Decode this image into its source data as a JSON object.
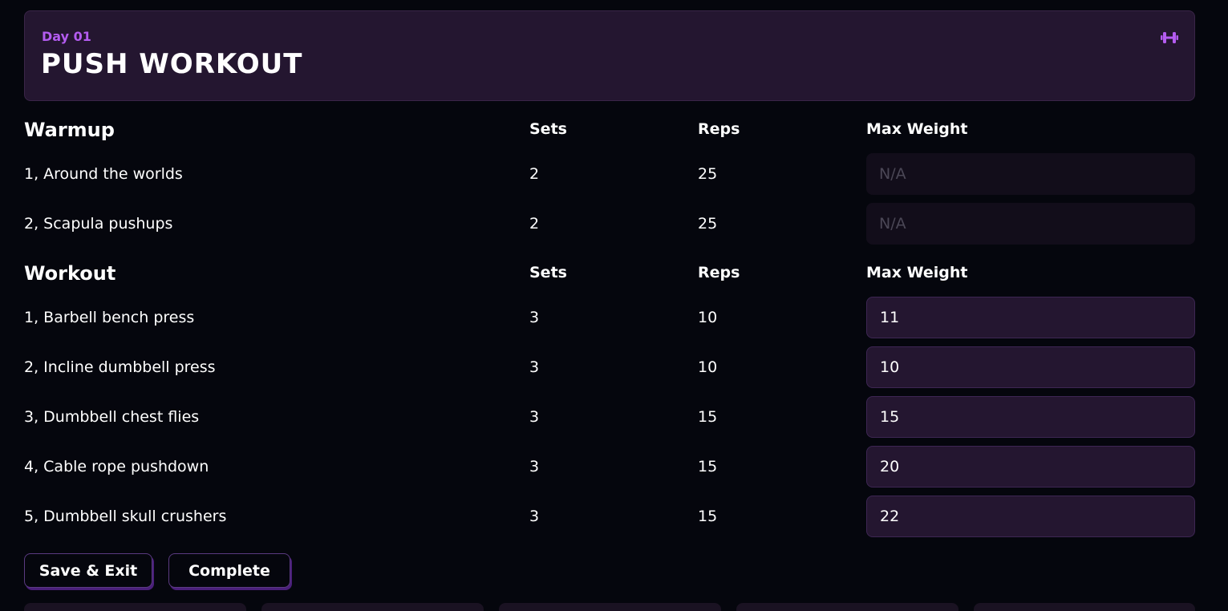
{
  "header": {
    "day_label": "Day 01",
    "title": "PUSH WORKOUT",
    "icon": "dumbbell-icon"
  },
  "columns": {
    "sets": "Sets",
    "reps": "Reps",
    "max_weight": "Max Weight"
  },
  "warmup": {
    "title": "Warmup",
    "rows": [
      {
        "name": "1, Around the worlds",
        "sets": "2",
        "reps": "25",
        "weight_placeholder": "N/A",
        "weight": ""
      },
      {
        "name": "2, Scapula pushups",
        "sets": "2",
        "reps": "25",
        "weight_placeholder": "N/A",
        "weight": ""
      }
    ]
  },
  "workout": {
    "title": "Workout",
    "rows": [
      {
        "name": "1, Barbell bench press",
        "sets": "3",
        "reps": "10",
        "weight": "11"
      },
      {
        "name": "2, Incline dumbbell press",
        "sets": "3",
        "reps": "10",
        "weight": "10"
      },
      {
        "name": "3, Dumbbell chest flies",
        "sets": "3",
        "reps": "15",
        "weight": "15"
      },
      {
        "name": "4, Cable rope pushdown",
        "sets": "3",
        "reps": "15",
        "weight": "20"
      },
      {
        "name": "5, Dumbbell skull crushers",
        "sets": "3",
        "reps": "15",
        "weight": "22"
      }
    ]
  },
  "actions": {
    "save_exit": "Save & Exit",
    "complete": "Complete"
  },
  "colors": {
    "background": "#05060d",
    "card": "#241630",
    "accent": "#b45cf0"
  }
}
